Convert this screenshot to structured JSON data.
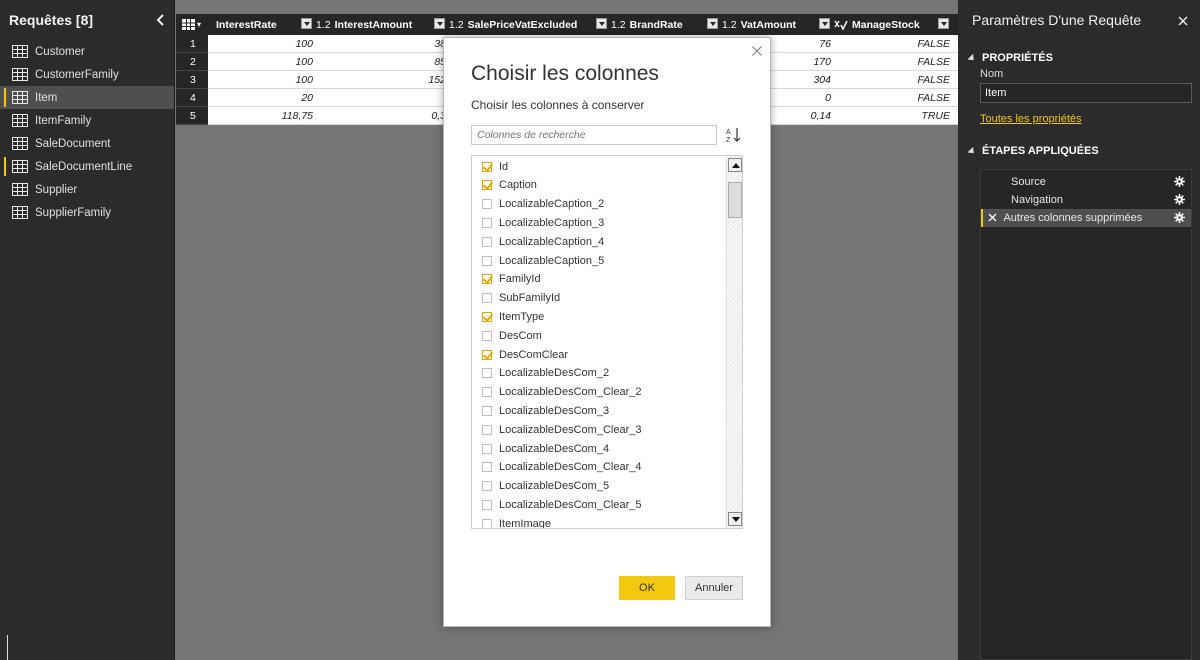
{
  "left": {
    "title": "Requêtes [8]",
    "queries": [
      {
        "label": "Customer"
      },
      {
        "label": "CustomerFamily"
      },
      {
        "label": "Item"
      },
      {
        "label": "ItemFamily"
      },
      {
        "label": "SaleDocument"
      },
      {
        "label": "SaleDocumentLine"
      },
      {
        "label": "Supplier"
      },
      {
        "label": "SupplierFamily"
      }
    ]
  },
  "grid": {
    "columns": [
      {
        "type": "",
        "label": "InterestRate"
      },
      {
        "type": "1.2",
        "label": "InterestAmount"
      },
      {
        "type": "1.2",
        "label": "SalePriceVatExcluded"
      },
      {
        "type": "1.2",
        "label": "BrandRate"
      },
      {
        "type": "1.2",
        "label": "VatAmount"
      },
      {
        "type": "",
        "label": "ManageStock"
      }
    ],
    "rows": [
      {
        "n": "1",
        "interest_rate": "100",
        "interest_amount": "38",
        "vat_amount": "76",
        "manage_stock": "FALSE"
      },
      {
        "n": "2",
        "interest_rate": "100",
        "interest_amount": "85",
        "vat_amount": "170",
        "manage_stock": "FALSE"
      },
      {
        "n": "3",
        "interest_rate": "100",
        "interest_amount": "152",
        "vat_amount": "304",
        "manage_stock": "FALSE"
      },
      {
        "n": "4",
        "interest_rate": "20",
        "interest_amount": "",
        "vat_amount": "0",
        "manage_stock": "FALSE"
      },
      {
        "n": "5",
        "interest_rate": "118,75",
        "interest_amount": "0,3",
        "vat_amount": "0,14",
        "manage_stock": "TRUE"
      }
    ]
  },
  "right": {
    "title": "Paramètres D'une Requête",
    "properties_header": "PROPRIÉTÉS",
    "name_label": "Nom",
    "name_value": "Item",
    "all_properties_link": "Toutes les propriétés",
    "steps_header": "ÉTAPES APPLIQUÉES",
    "steps": [
      {
        "label": "Source"
      },
      {
        "label": "Navigation"
      },
      {
        "label": "Autres colonnes supprimées"
      }
    ]
  },
  "dialog": {
    "title": "Choisir les colonnes",
    "subtitle": "Choisir les colonnes à conserver",
    "search_placeholder": "Colonnes de recherche",
    "columns": [
      {
        "label": "Id",
        "checked": true
      },
      {
        "label": "Caption",
        "checked": true
      },
      {
        "label": "LocalizableCaption_2",
        "checked": false
      },
      {
        "label": "LocalizableCaption_3",
        "checked": false
      },
      {
        "label": "LocalizableCaption_4",
        "checked": false
      },
      {
        "label": "LocalizableCaption_5",
        "checked": false
      },
      {
        "label": "FamilyId",
        "checked": true
      },
      {
        "label": "SubFamilyId",
        "checked": false
      },
      {
        "label": "ItemType",
        "checked": true
      },
      {
        "label": "DesCom",
        "checked": false
      },
      {
        "label": "DesComClear",
        "checked": true
      },
      {
        "label": "LocalizableDesCom_2",
        "checked": false
      },
      {
        "label": "LocalizableDesCom_Clear_2",
        "checked": false
      },
      {
        "label": "LocalizableDesCom_3",
        "checked": false
      },
      {
        "label": "LocalizableDesCom_Clear_3",
        "checked": false
      },
      {
        "label": "LocalizableDesCom_4",
        "checked": false
      },
      {
        "label": "LocalizableDesCom_Clear_4",
        "checked": false
      },
      {
        "label": "LocalizableDesCom_5",
        "checked": false
      },
      {
        "label": "LocalizableDesCom_Clear_5",
        "checked": false
      },
      {
        "label": "ItemImage",
        "checked": false
      }
    ],
    "ok_label": "OK",
    "cancel_label": "Annuler"
  },
  "colors": {
    "accent": "#f2c811",
    "panel": "#2b2b2b",
    "canvas": "#757575"
  }
}
